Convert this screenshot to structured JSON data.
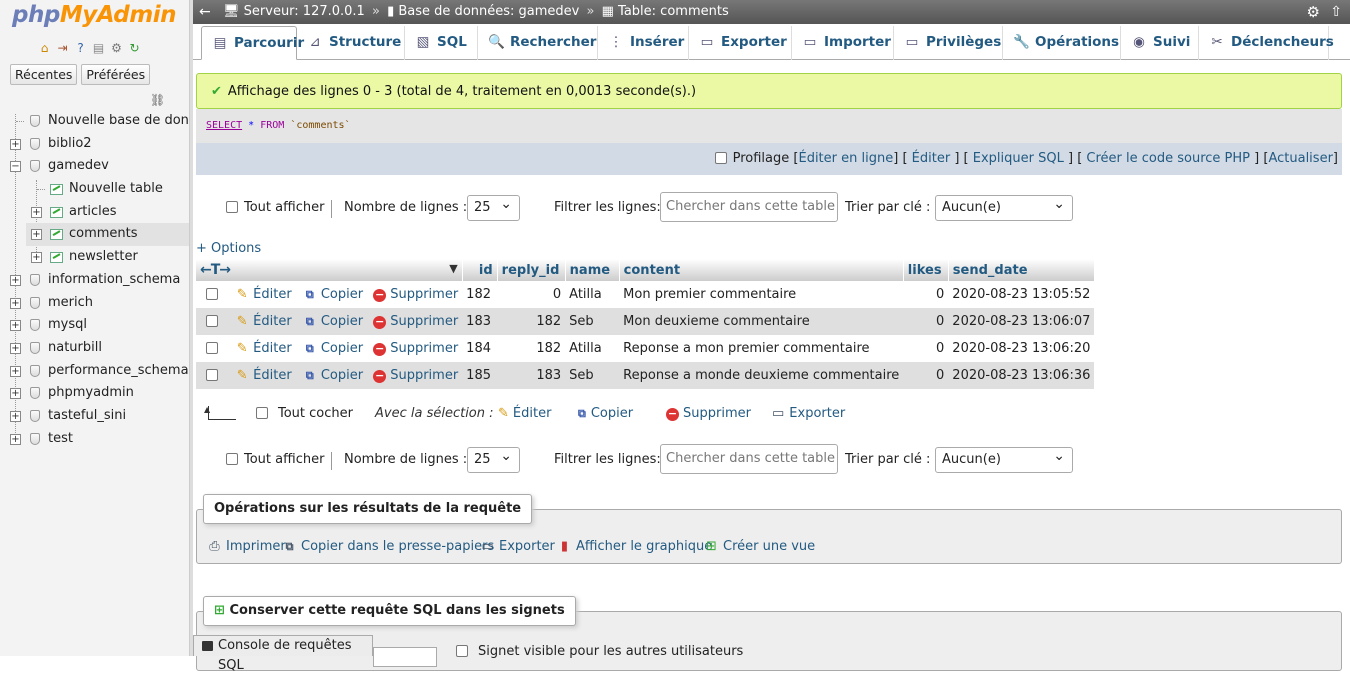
{
  "sidebar": {
    "logo_php": "php",
    "logo_myadmin": "MyAdmin",
    "recent_label": "Récentes",
    "favorites_label": "Préférées",
    "nav_icons": [
      "home-icon",
      "logout-icon",
      "help-icon",
      "docs-icon",
      "settings-icon",
      "reload-icon"
    ],
    "new_database": "Nouvelle base de donné",
    "databases": [
      {
        "name": "biblio2"
      },
      {
        "name": "gamedev"
      },
      {
        "name": "information_schema"
      },
      {
        "name": "merich"
      },
      {
        "name": "mysql"
      },
      {
        "name": "naturbill"
      },
      {
        "name": "performance_schema"
      },
      {
        "name": "phpmyadmin"
      },
      {
        "name": "tasteful_sini"
      },
      {
        "name": "test"
      }
    ],
    "gamedev_children": {
      "new_table": "Nouvelle table",
      "tables": [
        "articles",
        "comments",
        "newsletter"
      ],
      "selected": "comments"
    }
  },
  "topbar": {
    "server": "Serveur: 127.0.0.1",
    "database": "Base de données: gamedev",
    "table": "Table: comments",
    "separator": "»"
  },
  "tabs": [
    {
      "label": "Parcourir",
      "icon": "browse-icon"
    },
    {
      "label": "Structure",
      "icon": "structure-icon"
    },
    {
      "label": "SQL",
      "icon": "sql-icon"
    },
    {
      "label": "Rechercher",
      "icon": "search-icon"
    },
    {
      "label": "Insérer",
      "icon": "insert-icon"
    },
    {
      "label": "Exporter",
      "icon": "export-icon"
    },
    {
      "label": "Importer",
      "icon": "import-icon"
    },
    {
      "label": "Privilèges",
      "icon": "privileges-icon"
    },
    {
      "label": "Opérations",
      "icon": "operations-icon"
    },
    {
      "label": "Suivi",
      "icon": "tracking-icon"
    },
    {
      "label": "Déclencheurs",
      "icon": "triggers-icon"
    }
  ],
  "message": {
    "success": "Affichage des lignes 0 - 3 (total de 4, traitement en 0,0013 seconde(s).)"
  },
  "query": {
    "select": "SELECT",
    "star": "*",
    "from": "FROM",
    "table": "`comments`"
  },
  "query_actions": {
    "profiling": "Profilage",
    "bracket_open": "[",
    "bracket_close": "]",
    "edit_inline": "Éditer en ligne",
    "edit": "Éditer",
    "explain": "Expliquer SQL",
    "php_code": "Créer le code source PHP",
    "refresh": "Actualiser"
  },
  "nav": {
    "show_all": "Tout afficher",
    "rows_label": "Nombre de lignes :",
    "rows_value": "25",
    "filter_label": "Filtrer les lignes:",
    "filter_placeholder": "Chercher dans cette table",
    "sort_label": "Trier par clé :",
    "sort_value": "Aucun(e)"
  },
  "options_link": "+ Options",
  "table": {
    "columns": [
      "id",
      "reply_id",
      "name",
      "content",
      "likes",
      "send_date"
    ],
    "action_labels": {
      "edit": "Éditer",
      "copy": "Copier",
      "delete": "Supprimer"
    },
    "rows": [
      {
        "id": "182",
        "reply_id": "0",
        "name": "Atilla",
        "content": "Mon premier commentaire",
        "likes": "0",
        "send_date": "2020-08-23 13:05:52"
      },
      {
        "id": "183",
        "reply_id": "182",
        "name": "Seb",
        "content": "Mon deuxieme commentaire",
        "likes": "0",
        "send_date": "2020-08-23 13:06:07"
      },
      {
        "id": "184",
        "reply_id": "182",
        "name": "Atilla",
        "content": "Reponse a mon premier commentaire",
        "likes": "0",
        "send_date": "2020-08-23 13:06:20"
      },
      {
        "id": "185",
        "reply_id": "183",
        "name": "Seb",
        "content": "Reponse a monde deuxieme commentaire",
        "likes": "0",
        "send_date": "2020-08-23 13:06:36"
      }
    ]
  },
  "with_selected": {
    "check_all": "Tout cocher",
    "label": "Avec la sélection :",
    "edit": "Éditer",
    "copy": "Copier",
    "delete": "Supprimer",
    "export": "Exporter"
  },
  "query_results_ops": {
    "legend": "Opérations sur les résultats de la requête",
    "print": "Imprimer",
    "copy_clipboard": "Copier dans le presse-papiers",
    "export": "Exporter",
    "chart": "Afficher le graphique",
    "create_view": "Créer une vue"
  },
  "bookmark": {
    "legend": "Conserver cette requête SQL dans les signets",
    "visible_label": "Signet visible pour les autres utilisateurs"
  },
  "console": {
    "label": "Console de requêtes SQL"
  }
}
